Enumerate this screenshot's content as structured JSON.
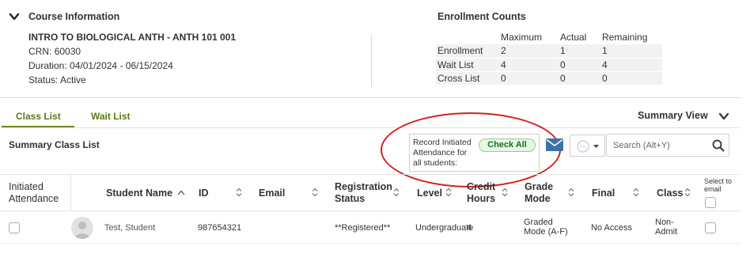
{
  "course_info": {
    "title": "Course Information",
    "course_name": "INTRO TO BIOLOGICAL ANTH - ANTH 101 001",
    "crn_label": "CRN:",
    "crn": "60030",
    "duration_label": "Duration:",
    "duration": "04/01/2024 - 06/15/2024",
    "status_label": "Status:",
    "status": "Active"
  },
  "enrollment": {
    "title": "Enrollment Counts",
    "columns": [
      "Maximum",
      "Actual",
      "Remaining"
    ],
    "rows": [
      {
        "label": "Enrollment",
        "maximum": "2",
        "actual": "1",
        "remaining": "1"
      },
      {
        "label": "Wait List",
        "maximum": "4",
        "actual": "0",
        "remaining": "4"
      },
      {
        "label": "Cross List",
        "maximum": "0",
        "actual": "0",
        "remaining": "0"
      }
    ]
  },
  "tabs": [
    {
      "label": "Class List",
      "active": true
    },
    {
      "label": "Wait List",
      "active": false
    }
  ],
  "summary_view_label": "Summary View",
  "list_title": "Summary Class List",
  "attendance": {
    "text": "Record Initiated Attendance for all students:",
    "check_all_label": "Check All"
  },
  "search": {
    "placeholder": "Search (Alt+Y)"
  },
  "table": {
    "headers": {
      "initiated_attendance": "Initiated Attendance",
      "student_name": "Student Name",
      "id": "ID",
      "email": "Email",
      "registration_status": "Registration Status",
      "level": "Level",
      "credit_hours": "Credit Hours",
      "grade_mode": "Grade Mode",
      "final": "Final",
      "class": "Class",
      "select_to_email": "Select to email"
    },
    "rows": [
      {
        "student_name": "Test, Student",
        "id": "987654321",
        "email": "",
        "registration_status": "**Registered**",
        "level": "Undergraduate",
        "credit_hours": "4",
        "grade_mode": "Graded Mode (A-F)",
        "final": "No Access",
        "class": "Non-Admit"
      }
    ]
  },
  "colors": {
    "accent_green": "#5a7a15",
    "annotation_red": "#d32020",
    "button_green": "#1f6d1f",
    "email_blue": "#3d72a8"
  },
  "icons": [
    "chevron-down-icon",
    "email-icon",
    "more-options-icon",
    "search-icon",
    "sort-icon",
    "sort-ascending-icon",
    "avatar-icon"
  ]
}
